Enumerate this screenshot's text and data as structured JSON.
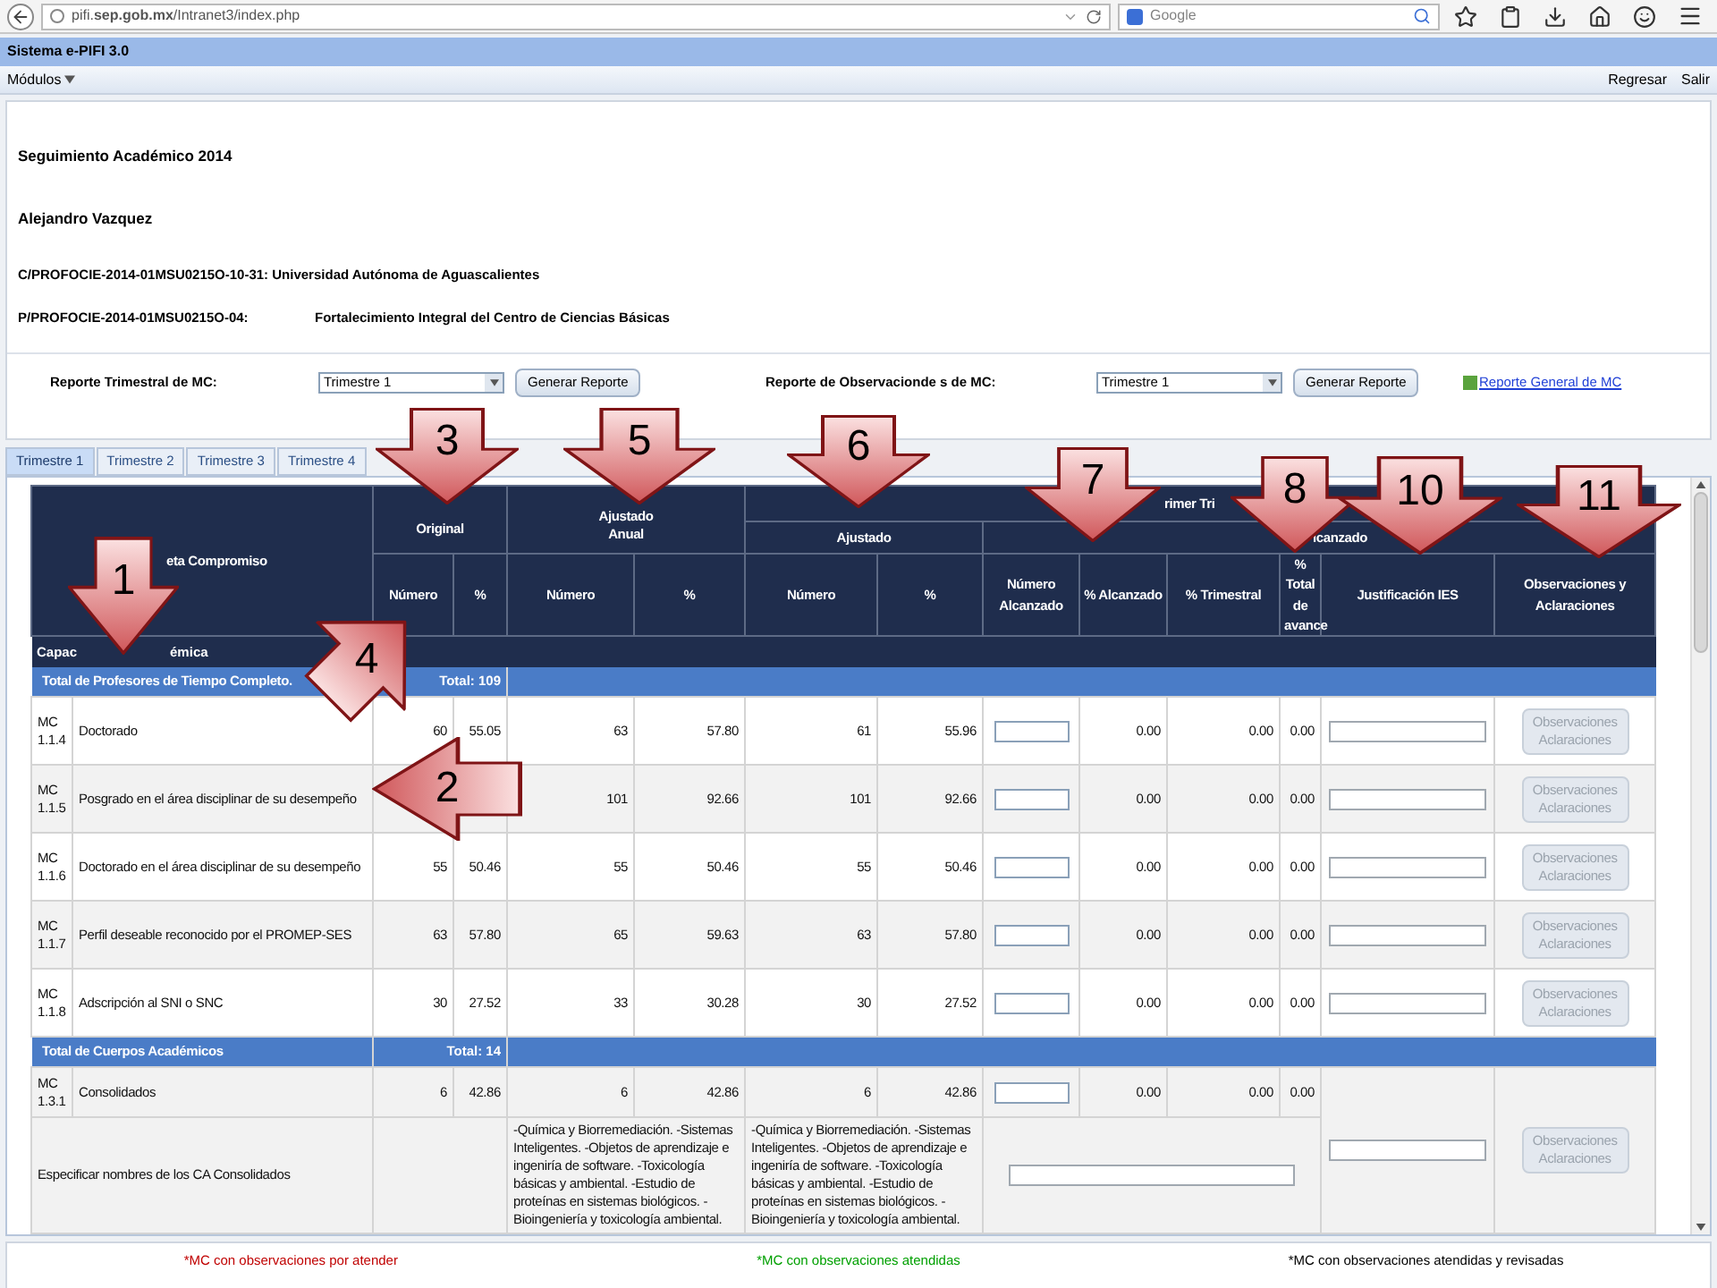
{
  "browser": {
    "url": "pifi.**sep.gob.mx**/Intranet3/index.php",
    "search_placeholder": "Google"
  },
  "app_title": "Sistema e-PIFI 3.0",
  "menu": {
    "modules": "Módulos",
    "links": [
      "Regresar",
      "Salir"
    ]
  },
  "header": {
    "title": "Seguimiento Académico 2014",
    "name": "Alejandro Vazquez",
    "line_1": "C/PROFOCIE-2014-01MSU0215O-10-31: Universidad Autónoma de Aguascalientes",
    "line_2": {
      "label": "P/PROFOCIE-2014-01MSU0215O-04:",
      "value": "Fortalecimiento Integral del Centro de Ciencias Básicas"
    }
  },
  "reports": [
    {
      "label": "Reporte Trimestral de MC:",
      "select_value": "Trimestre 1",
      "button": "Generar Reporte"
    },
    {
      "label": "Reporte de Observacionde s de MC:",
      "select_value": "Trimestre 1",
      "button": "Generar Reporte"
    }
  ],
  "general_report_link": "Reporte General de MC",
  "tabs": [
    {
      "label": "Trimestre 1",
      "selected": true
    },
    {
      "label": "Trimestre 2",
      "selected": false
    },
    {
      "label": "Trimestre 3",
      "selected": false
    },
    {
      "label": "Trimestre 4",
      "selected": false
    }
  ],
  "table": {
    "header": {
      "meta": "eta Compromiso",
      "original": "Original",
      "annual": "Ajustado Anual",
      "quarter": "rimer Tri",
      "adjusted": "Ajustado",
      "reached": "lcanzado",
      "columns": [
        "Número",
        "%",
        "Número",
        "%",
        "Número",
        "%",
        "Número Alcanzado",
        "% Alcanzado",
        "% Trimestral",
        "% Total de avance",
        "Justificación IES",
        "Observaciones y Aclaraciones"
      ]
    },
    "rows": [
      {
        "kind": "category",
        "parts": [
          "Capac",
          "émica"
        ]
      },
      {
        "kind": "total",
        "label": "Total de Profesores de Tiempo Completo.",
        "total": "Total: 109"
      },
      {
        "kind": "item",
        "code": "MC 1.1.4",
        "description": "Doctorado",
        "original": [
          "60",
          "55.05"
        ],
        "annual": [
          "63",
          "57.80"
        ],
        "adjusted": [
          "61",
          "55.96"
        ],
        "reached": [
          "0.00",
          "0.00",
          "0.00"
        ],
        "button": "Observaciones Aclaraciones"
      },
      {
        "kind": "item",
        "code": "MC 1.1.5",
        "description": "Posgrado en el área disciplinar de su desempeño",
        "annual": [
          "101",
          "92.66"
        ],
        "adjusted": [
          "101",
          "92.66"
        ],
        "reached": [
          "0.00",
          "0.00",
          "0.00"
        ],
        "button": "Observaciones Aclaraciones"
      },
      {
        "kind": "item",
        "code": "MC 1.1.6",
        "description": "Doctorado en el área disciplinar de su desempeño",
        "original": [
          "55",
          "50.46"
        ],
        "annual": [
          "55",
          "50.46"
        ],
        "adjusted": [
          "55",
          "50.46"
        ],
        "reached": [
          "0.00",
          "0.00",
          "0.00"
        ],
        "button": "Observaciones Aclaraciones"
      },
      {
        "kind": "item",
        "code": "MC 1.1.7",
        "description": "Perfil deseable reconocido por el PROMEP-SES",
        "original": [
          "63",
          "57.80"
        ],
        "annual": [
          "65",
          "59.63"
        ],
        "adjusted": [
          "63",
          "57.80"
        ],
        "reached": [
          "0.00",
          "0.00",
          "0.00"
        ],
        "button": "Observaciones Aclaraciones"
      },
      {
        "kind": "item",
        "code": "MC 1.1.8",
        "description": "Adscripción al SNI o SNC",
        "original": [
          "30",
          "27.52"
        ],
        "annual": [
          "33",
          "30.28"
        ],
        "adjusted": [
          "30",
          "27.52"
        ],
        "reached": [
          "0.00",
          "0.00",
          "0.00"
        ],
        "button": "Observaciones Aclaraciones"
      },
      {
        "kind": "total",
        "label": "Total de Cuerpos Académicos",
        "total": "Total: 14"
      },
      {
        "kind": "item_merged",
        "code": "MC 1.3.1",
        "description": "Consolidados",
        "original": [
          "6",
          "42.86"
        ],
        "annual": [
          "6",
          "42.86"
        ],
        "adjusted": [
          "6",
          "42.86"
        ],
        "reached": [
          "0.00",
          "0.00",
          "0.00"
        ],
        "button": "Observaciones Aclaraciones"
      },
      {
        "kind": "names",
        "description": "Especificar nombres de los CA Consolidados",
        "annual_text": "-Química y Biorremediación. -Sistemas Inteligentes. -Objetos de aprendizaje e ingeniría de software. -Toxicología básicas y ambiental. -Estudio de proteínas en sistemas biológicos. -Bioingeniería y toxicología ambiental.",
        "adjusted_text": "-Química y Biorremediación. -Sistemas Inteligentes. -Objetos de aprendizaje e ingeniría de software. -Toxicología básicas y ambiental. -Estudio de proteínas en sistemas biológicos. -Bioingeniería y toxicología ambiental."
      }
    ]
  },
  "legend": [
    {
      "text": "*MC con observaciones por atender",
      "color": "#c00000"
    },
    {
      "text": "*MC con observaciones atendidas",
      "color": "#00a000"
    },
    {
      "text": "*MC con observaciones atendidas y revisadas",
      "color": "#000000"
    }
  ],
  "callouts": [
    {
      "label": "3",
      "kind": "down"
    },
    {
      "label": "5",
      "kind": "down"
    },
    {
      "label": "6",
      "kind": "down"
    },
    {
      "label": "7",
      "kind": "down"
    },
    {
      "label": "8",
      "kind": "down"
    },
    {
      "label": "10",
      "kind": "down"
    },
    {
      "label": "11",
      "kind": "down"
    },
    {
      "label": "1",
      "kind": "down"
    },
    {
      "label": "4",
      "kind": "up_right"
    },
    {
      "label": "2",
      "kind": "left"
    }
  ]
}
